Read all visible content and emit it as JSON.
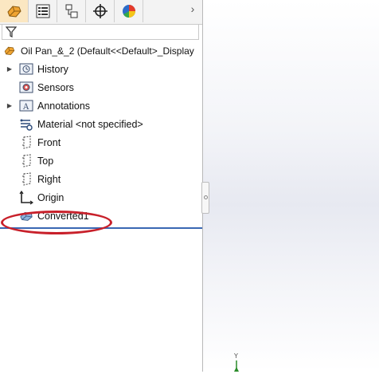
{
  "tabs": [
    {
      "name": "featuremanager-tab",
      "icon": "part-icon",
      "active": true
    },
    {
      "name": "propertymanager-tab",
      "icon": "property-list-icon",
      "active": false
    },
    {
      "name": "configurationmanager-tab",
      "icon": "configuration-icon",
      "active": false
    },
    {
      "name": "dimxpertmanager-tab",
      "icon": "crosshair-icon",
      "active": false
    },
    {
      "name": "displaymanager-tab",
      "icon": "appearance-pie-icon",
      "active": false
    }
  ],
  "tab_overflow": "›",
  "tree": {
    "root_label": "Oil Pan_&_2  (Default<<Default>_Display",
    "items": [
      {
        "label": "History",
        "icon": "history-folder-icon",
        "expandable": true
      },
      {
        "label": "Sensors",
        "icon": "sensors-folder-icon",
        "expandable": false
      },
      {
        "label": "Annotations",
        "icon": "annotations-folder-icon",
        "expandable": true
      },
      {
        "label": "Material <not specified>",
        "icon": "material-icon",
        "expandable": false
      },
      {
        "label": "Front",
        "icon": "plane-icon",
        "expandable": false
      },
      {
        "label": "Top",
        "icon": "plane-icon",
        "expandable": false
      },
      {
        "label": "Right",
        "icon": "plane-icon",
        "expandable": false
      },
      {
        "label": "Origin",
        "icon": "origin-icon",
        "expandable": false
      },
      {
        "label": "Converted1",
        "icon": "imported-body-icon",
        "expandable": false
      }
    ]
  },
  "triad_axis_label": "Y",
  "colors": {
    "highlight": "#c8202a",
    "rollback_bar": "#3a67b3",
    "active_tab": "#fbe7c2"
  }
}
